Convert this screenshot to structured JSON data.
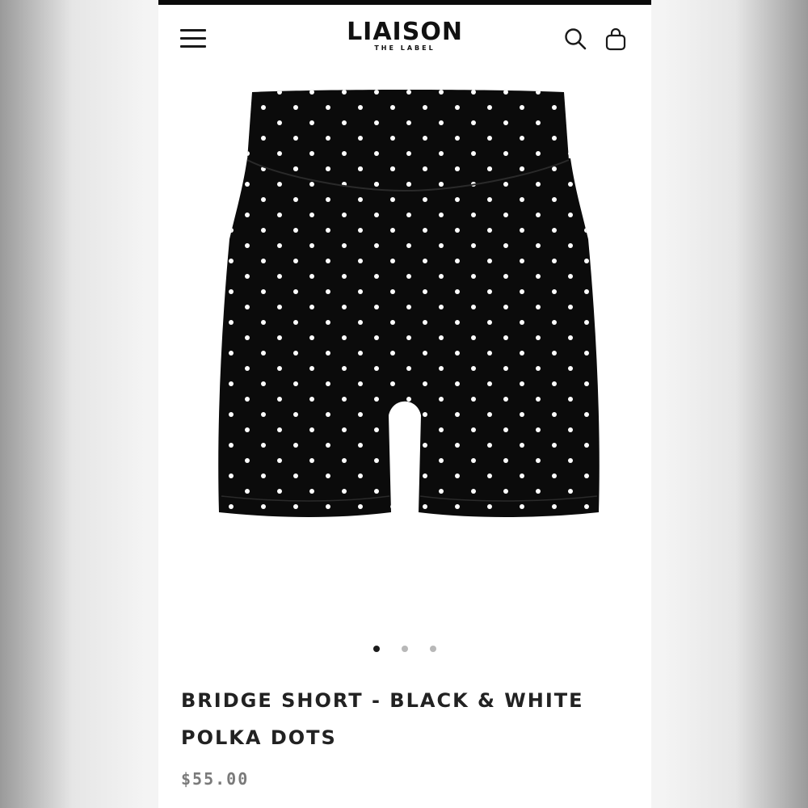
{
  "brand": {
    "name": "LIAISON",
    "tagline": "THE LABEL"
  },
  "header": {
    "menu_icon": "hamburger-menu-icon",
    "search_icon": "search-icon",
    "cart_icon": "shopping-bag-icon"
  },
  "gallery": {
    "image_count": 3,
    "active_index": 0,
    "garment_color": "#0b0b0b",
    "dot_color": "#ffffff"
  },
  "product": {
    "title_line1": "BRIDGE SHORT - BLACK & WHITE",
    "title_line2": "POLKA DOTS",
    "price": "$55.00"
  },
  "colors": {
    "text": "#222222",
    "price": "#7a7a7a",
    "indicator_active": "#1b1b1b",
    "indicator_inactive": "#b8b8b8"
  }
}
